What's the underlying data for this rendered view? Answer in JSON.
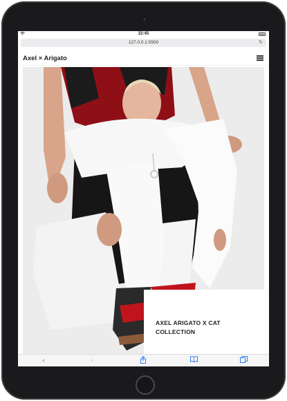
{
  "status_bar": {
    "time": "22:45"
  },
  "browser": {
    "url": "127.0.0.1:5500"
  },
  "site": {
    "title": "Axel × Arigato"
  },
  "hero": {
    "caption": "AXEL ARIGATO X CAT COLLECTION"
  },
  "toolbar": {
    "back_icon": "back-chevron-icon",
    "forward_icon": "forward-chevron-icon",
    "share_icon": "share-icon",
    "bookmarks_icon": "bookmarks-icon",
    "tabs_icon": "tabs-icon"
  },
  "colors": {
    "accent": "#2f7bf5",
    "device_frame": "#1a1a1c",
    "jacket_red": "#b3121c"
  }
}
